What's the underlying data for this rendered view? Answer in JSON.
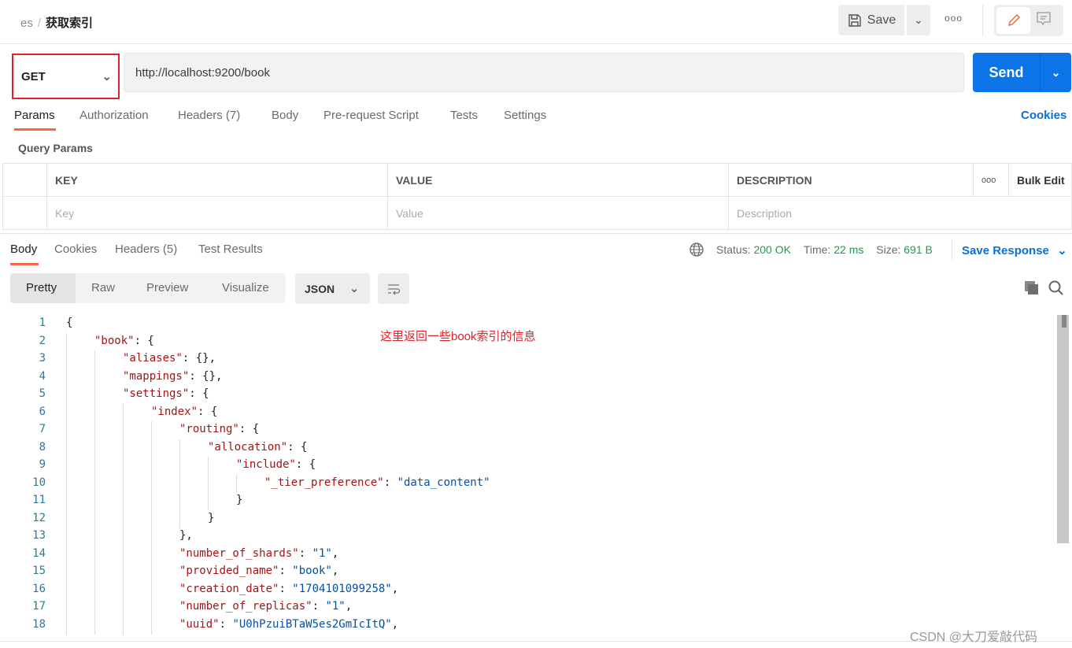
{
  "header": {
    "breadcrumb_parent": "es",
    "breadcrumb_separator": "/",
    "title": "获取索引",
    "save_label": "Save"
  },
  "request": {
    "method": "GET",
    "url": "http://localhost:9200/book",
    "send_label": "Send"
  },
  "request_tabs": [
    {
      "label": "Params"
    },
    {
      "label": "Authorization"
    },
    {
      "label": "Headers",
      "count": "(7)"
    },
    {
      "label": "Body"
    },
    {
      "label": "Pre-request Script"
    },
    {
      "label": "Tests"
    },
    {
      "label": "Settings"
    }
  ],
  "cookies_label": "Cookies",
  "query_params": {
    "title": "Query Params",
    "columns": [
      "KEY",
      "VALUE",
      "DESCRIPTION"
    ],
    "bulk_edit": "Bulk Edit",
    "placeholders": [
      "Key",
      "Value",
      "Description"
    ]
  },
  "response_tabs": [
    {
      "label": "Body"
    },
    {
      "label": "Cookies"
    },
    {
      "label": "Headers",
      "count": "(5)"
    },
    {
      "label": "Test Results"
    }
  ],
  "status": {
    "status_label": "Status:",
    "status": "200 OK",
    "time_label": "Time:",
    "time": "22 ms",
    "size_label": "Size:",
    "size": "691 B",
    "save_response": "Save Response"
  },
  "view_modes": [
    "Pretty",
    "Raw",
    "Preview",
    "Visualize"
  ],
  "format": "JSON",
  "annotation": "这里返回一些book索引的信息",
  "watermark": "CSDN @大刀爱敲代码",
  "colors": {
    "accent": "#0c74e6",
    "active_tab": "#f26b3a",
    "annotation": "#e0222a",
    "success": "#1f9d48"
  },
  "code_lines": [
    {
      "n": "1",
      "i": 0,
      "k": "",
      "p": "{",
      "v": "",
      "e": ""
    },
    {
      "n": "2",
      "i": 1,
      "k": "\"book\"",
      "p": ": {",
      "v": "",
      "e": ""
    },
    {
      "n": "3",
      "i": 2,
      "k": "\"aliases\"",
      "p": ": {},",
      "v": "",
      "e": ""
    },
    {
      "n": "4",
      "i": 2,
      "k": "\"mappings\"",
      "p": ": {},",
      "v": "",
      "e": ""
    },
    {
      "n": "5",
      "i": 2,
      "k": "\"settings\"",
      "p": ": {",
      "v": "",
      "e": ""
    },
    {
      "n": "6",
      "i": 3,
      "k": "\"index\"",
      "p": ": {",
      "v": "",
      "e": ""
    },
    {
      "n": "7",
      "i": 4,
      "k": "\"routing\"",
      "p": ": {",
      "v": "",
      "e": ""
    },
    {
      "n": "8",
      "i": 5,
      "k": "\"allocation\"",
      "p": ": {",
      "v": "",
      "e": ""
    },
    {
      "n": "9",
      "i": 6,
      "k": "\"include\"",
      "p": ": {",
      "v": "",
      "e": ""
    },
    {
      "n": "10",
      "i": 7,
      "k": "\"_tier_preference\"",
      "p": ": ",
      "v": "\"data_content\"",
      "e": ""
    },
    {
      "n": "11",
      "i": 6,
      "k": "",
      "p": "}",
      "v": "",
      "e": ""
    },
    {
      "n": "12",
      "i": 5,
      "k": "",
      "p": "}",
      "v": "",
      "e": ""
    },
    {
      "n": "13",
      "i": 4,
      "k": "",
      "p": "},",
      "v": "",
      "e": ""
    },
    {
      "n": "14",
      "i": 4,
      "k": "\"number_of_shards\"",
      "p": ": ",
      "v": "\"1\"",
      "e": ","
    },
    {
      "n": "15",
      "i": 4,
      "k": "\"provided_name\"",
      "p": ": ",
      "v": "\"book\"",
      "e": ","
    },
    {
      "n": "16",
      "i": 4,
      "k": "\"creation_date\"",
      "p": ": ",
      "v": "\"1704101099258\"",
      "e": ","
    },
    {
      "n": "17",
      "i": 4,
      "k": "\"number_of_replicas\"",
      "p": ": ",
      "v": "\"1\"",
      "e": ","
    },
    {
      "n": "18",
      "i": 4,
      "k": "\"uuid\"",
      "p": ": ",
      "v": "\"U0hPzuiBTaW5es2GmIcItQ\"",
      "e": ","
    }
  ]
}
